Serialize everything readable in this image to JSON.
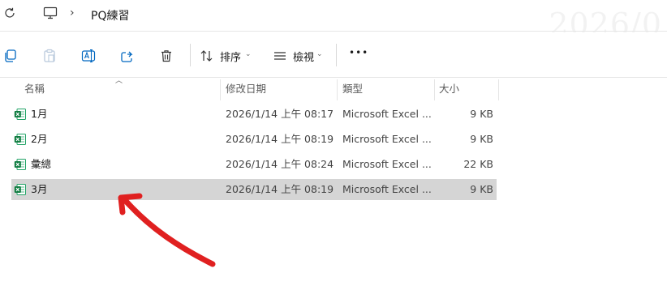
{
  "address_bar": {
    "breadcrumb_separator": "›",
    "folder_name": "PQ練習",
    "watermark_text": "2026/0"
  },
  "toolbar": {
    "sort_label": "排序",
    "view_label": "檢視",
    "more_label": "•••"
  },
  "columns": {
    "name": "名稱",
    "date": "修改日期",
    "type": "類型",
    "size": "大小"
  },
  "files": [
    {
      "name": "1月",
      "date": "2026/1/14 上午 08:17",
      "type": "Microsoft Excel ...",
      "size": "9 KB"
    },
    {
      "name": "2月",
      "date": "2026/1/14 上午 08:19",
      "type": "Microsoft Excel ...",
      "size": "9 KB"
    },
    {
      "name": "彙總",
      "date": "2026/1/14 上午 08:24",
      "type": "Microsoft Excel ...",
      "size": "22 KB"
    },
    {
      "name": "3月",
      "date": "2026/1/14 上午 08:19",
      "type": "Microsoft Excel ...",
      "size": "9 KB"
    }
  ],
  "selected_file_index": 3,
  "colors": {
    "selected_row": "#d5d5d5",
    "annotation_arrow": "#e02020",
    "excel_green": "#107c41"
  }
}
